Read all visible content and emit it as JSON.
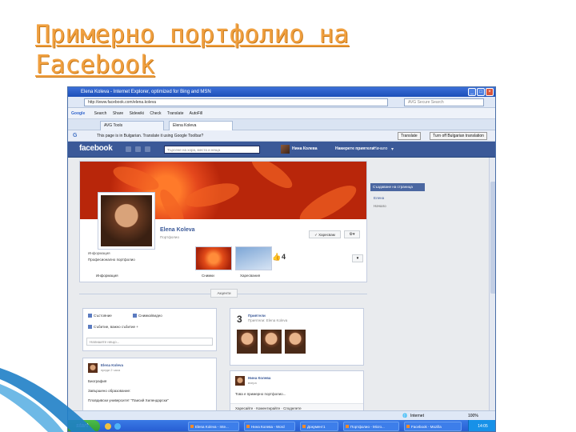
{
  "slide": {
    "title": "Примерно портфолио на Facebook"
  },
  "browser": {
    "window_title": "Elena Koleva - Internet Explorer, optimized for Bing and MSN",
    "address": "http://www.facebook.com/elena.koleva",
    "search_placeholder": "AVG Secure Search",
    "toolbar_google": "Google",
    "toolbar_items": [
      "Search",
      "Share",
      "Sidewiki",
      "Check",
      "Translate",
      "AutoFill"
    ],
    "tabs": [
      "AVG Tools",
      "Elena Koleva"
    ],
    "translate_msg": "This page is in Bulgarian. Translate it using Google Toolbar?",
    "translate_btn": "Translate",
    "turnoff_btn": "Turn off Bulgarian translation"
  },
  "facebook": {
    "logo": "facebook",
    "search_placeholder": "Търсене на хора, места и неща",
    "user": "Нина Колева",
    "create": "Намерете приятели",
    "home": "Начало",
    "profile_name": "Elena Koleva",
    "profile_sub": "Портфолио",
    "like_btn": "Харесвам",
    "info_top": "Информация",
    "info_cat": "Професионално портфолио",
    "likes_count": "4",
    "labels": [
      "Информация",
      "Снимки",
      "Харесвания"
    ],
    "side_btn": "Създаване на страница",
    "side_a": "Елена",
    "side_b": "Начало",
    "sep_btn": "Акценти",
    "card1": {
      "r1": "Състояние",
      "r2": "Снимка/видео",
      "r3": "Събитие, важно събитие +",
      "box": "Напишете нещо..."
    },
    "card2": {
      "num": "3",
      "t1": "Приятели",
      "t2": "Приятели: Elena Koleva"
    },
    "card3": {
      "nm": "Elena Koleva",
      "dt": "преди 2 часа",
      "l1": "Биография",
      "l2": "Завършено образование:",
      "l3": "Пловдивски университет \"Паисий Хилендарски\""
    },
    "card4": {
      "nm": "Нина Колева",
      "dt": "вчера",
      "l1": "Това е примерно портфолио...",
      "sub": "Харесайте · Коментирайте · Споделете"
    }
  },
  "status": {
    "zone": "Internet",
    "zoom": "100%"
  },
  "taskbar": {
    "start": "start",
    "items": [
      "Elena Koleva - Inte...",
      "Нина Колева - Word",
      "Документ1",
      "Портфолио - Micro...",
      "Facebook - Mozilla"
    ],
    "clock": "14:05"
  },
  "colors": {
    "facebook_blue": "#3b5998",
    "title_orange": "#f0a040"
  }
}
